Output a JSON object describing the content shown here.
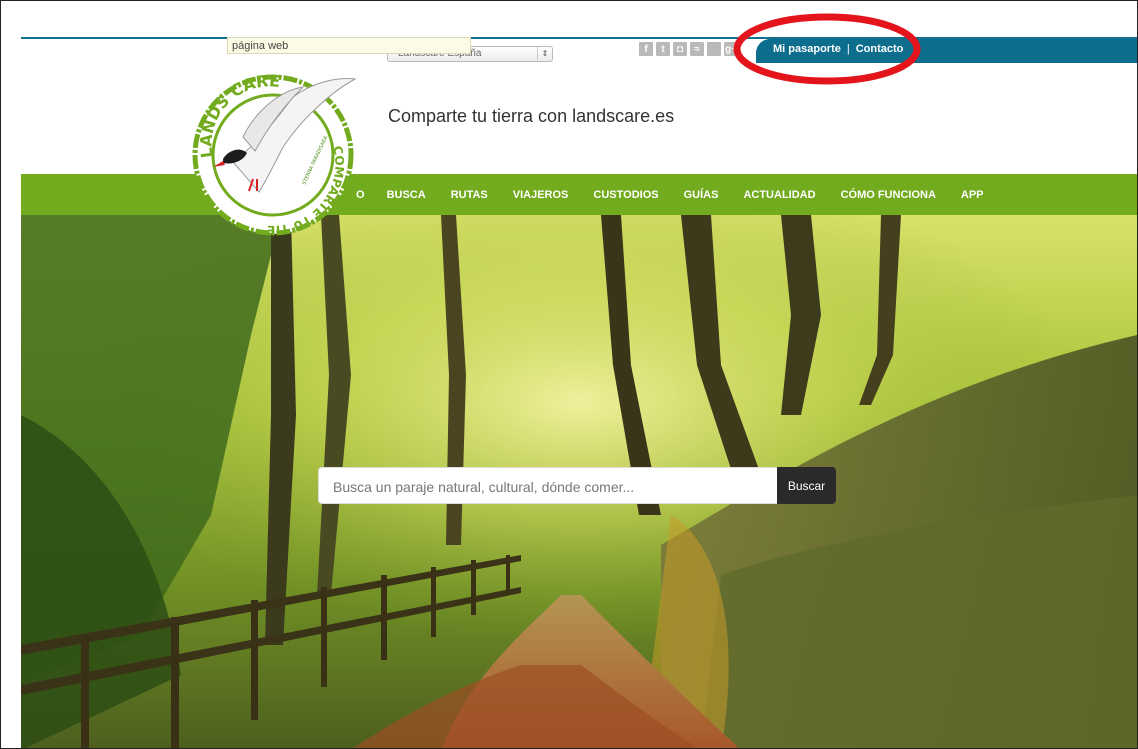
{
  "tooltip": {
    "text": "página web"
  },
  "country_select": {
    "value": "Landscare España",
    "arrows": "⇕"
  },
  "social": {
    "facebook": "f",
    "twitter": "t",
    "instagram": "◘",
    "rss": "≈",
    "other": "",
    "googleplus": "g+"
  },
  "account": {
    "passport": "Mi pasaporte",
    "separator": "|",
    "contact": "Contacto"
  },
  "tagline": "Comparte tu tierra con landscare.es",
  "nav": {
    "partial": "O",
    "items": [
      "BUSCA",
      "RUTAS",
      "VIAJEROS",
      "CUSTODIOS",
      "GUÍAS",
      "ACTUALIDAD",
      "CÓMO FUNCIONA",
      "APP"
    ]
  },
  "logo": {
    "top_text": "LANDS CARE",
    "side_text": "COMPARTE TU TIERRA",
    "bird_text": "STERNA PARADISAEA"
  },
  "search": {
    "placeholder": "Busca un paraje natural, cultural, dónde comer...",
    "button": "Buscar"
  },
  "colors": {
    "brand_green": "#72ab1d",
    "brand_teal": "#0d6d8d",
    "annotation_red": "#e3141b"
  }
}
